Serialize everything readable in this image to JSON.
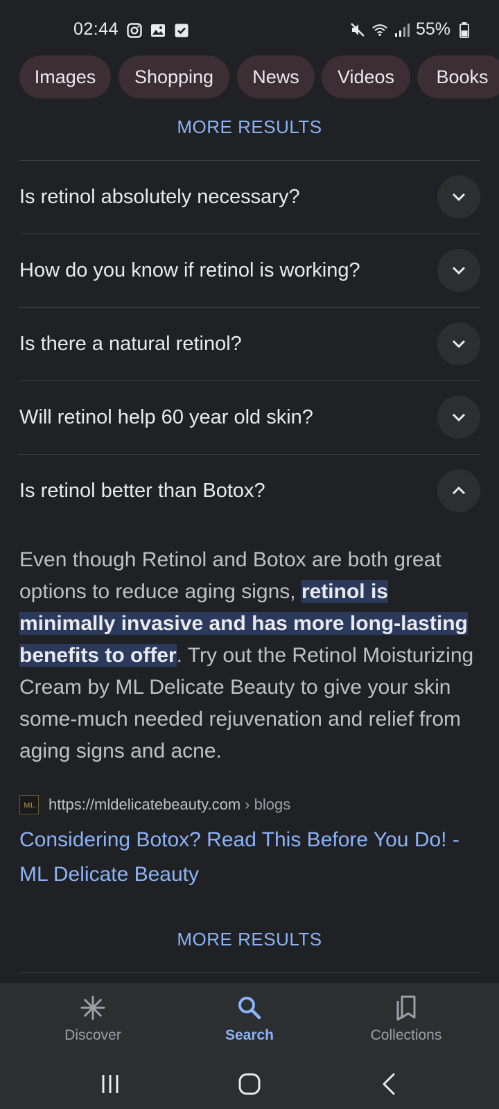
{
  "status_bar": {
    "time": "02:44",
    "battery": "55%",
    "left_icons": [
      "instagram-icon",
      "gallery-icon",
      "checkbox-icon"
    ],
    "right_icons": [
      "mute-icon",
      "wifi-icon",
      "signal-icon",
      "battery-icon"
    ]
  },
  "chips": [
    "Images",
    "Shopping",
    "News",
    "Videos",
    "Books"
  ],
  "more_results_top": "MORE RESULTS",
  "faq": [
    {
      "question": "Is retinol absolutely necessary?",
      "expanded": false
    },
    {
      "question": "How do you know if retinol is working?",
      "expanded": false
    },
    {
      "question": "Is there a natural retinol?",
      "expanded": false
    },
    {
      "question": "Will retinol help 60 year old skin?",
      "expanded": false
    },
    {
      "question": "Is retinol better than Botox?",
      "expanded": true
    }
  ],
  "answer": {
    "before": "Even though Retinol and Botox are both great options to reduce aging signs, ",
    "highlight": "retinol is minimally invasive and has more long-lasting benefits to offer",
    "after": ". Try out the Retinol Moisturizing Cream by ML Delicate Beauty to give your skin some-much needed rejuvenation and relief from aging signs and acne."
  },
  "source": {
    "favicon_text": "ML",
    "url": "https://mldelicatebeauty.com",
    "crumb": "› blogs",
    "title": "Considering Botox? Read This Before You Do! - ML Delicate Beauty"
  },
  "more_results_bottom": "MORE RESULTS",
  "bottom_nav": [
    {
      "label": "Discover",
      "icon": "asterisk-icon",
      "active": false
    },
    {
      "label": "Search",
      "icon": "search-icon",
      "active": true
    },
    {
      "label": "Collections",
      "icon": "collections-icon",
      "active": false
    }
  ],
  "colors": {
    "background": "#202124",
    "accent": "#8ab4f8",
    "chip_bg": "#3c2e33",
    "highlight_bg": "#2b3a5c"
  }
}
